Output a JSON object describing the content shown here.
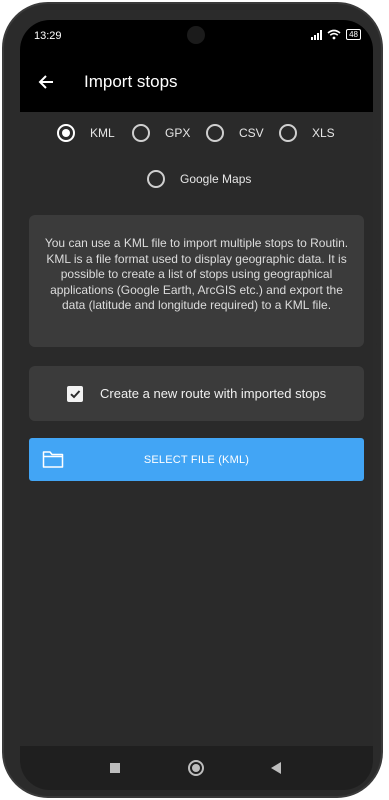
{
  "status_bar": {
    "time": "13:29",
    "battery": "48",
    "icons": [
      "signal-icon",
      "wifi-icon",
      "battery-icon"
    ]
  },
  "app_bar": {
    "title": "Import stops",
    "back_icon": "arrow-back-icon"
  },
  "import_formats": {
    "selected": "KML",
    "options": [
      "KML",
      "GPX",
      "CSV",
      "XLS",
      "Google Maps"
    ]
  },
  "info_text": "You can use a KML file to import multiple stops to Routin. KML is a file format used to display geographic data. It is possible to create a list of stops using geographical applications (Google Earth, ArcGIS etc.) and export the data (latitude and longitude required) to a KML file.",
  "create_route": {
    "label": "Create a new route with imported stops",
    "checked": true
  },
  "select_file_button": {
    "label": "SELECT FILE (KML)",
    "icon": "folder-icon",
    "color": "#42a5f5"
  },
  "nav_bar": {
    "icons": [
      "recents-square-icon",
      "home-circle-icon",
      "back-triangle-icon"
    ]
  }
}
